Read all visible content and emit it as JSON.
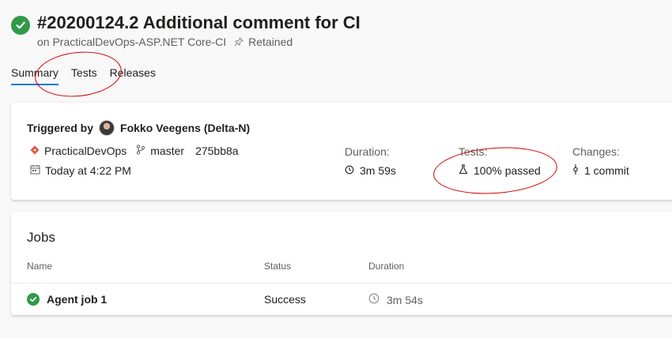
{
  "header": {
    "title": "#20200124.2 Additional comment for CI",
    "pipeline": "on PracticalDevOps-ASP.NET Core-CI",
    "retained": "Retained"
  },
  "tabs": [
    {
      "label": "Summary",
      "active": true
    },
    {
      "label": "Tests",
      "active": false
    },
    {
      "label": "Releases",
      "active": false
    }
  ],
  "summary": {
    "triggered_label": "Triggered by",
    "triggered_user": "Fokko Veegens (Delta-N)",
    "repo": "PracticalDevOps",
    "branch": "master",
    "commit": "275bb8a",
    "date": "Today at 4:22 PM",
    "duration_label": "Duration:",
    "duration_value": "3m 59s",
    "tests_label": "Tests:",
    "tests_value": "100% passed",
    "changes_label": "Changes:",
    "changes_value": "1 commit"
  },
  "jobs": {
    "title": "Jobs",
    "columns": [
      "Name",
      "Status",
      "Duration"
    ],
    "rows": [
      {
        "name": "Agent job 1",
        "status": "Success",
        "duration": "3m 54s"
      }
    ]
  },
  "colors": {
    "success": "#339947",
    "accent": "#0078d4",
    "annotation": "#d40000"
  },
  "icons": [
    "check-circle-icon",
    "pin-icon",
    "repo-icon",
    "branch-icon",
    "calendar-icon",
    "clock-icon",
    "flask-icon",
    "commit-icon",
    "avatar"
  ]
}
